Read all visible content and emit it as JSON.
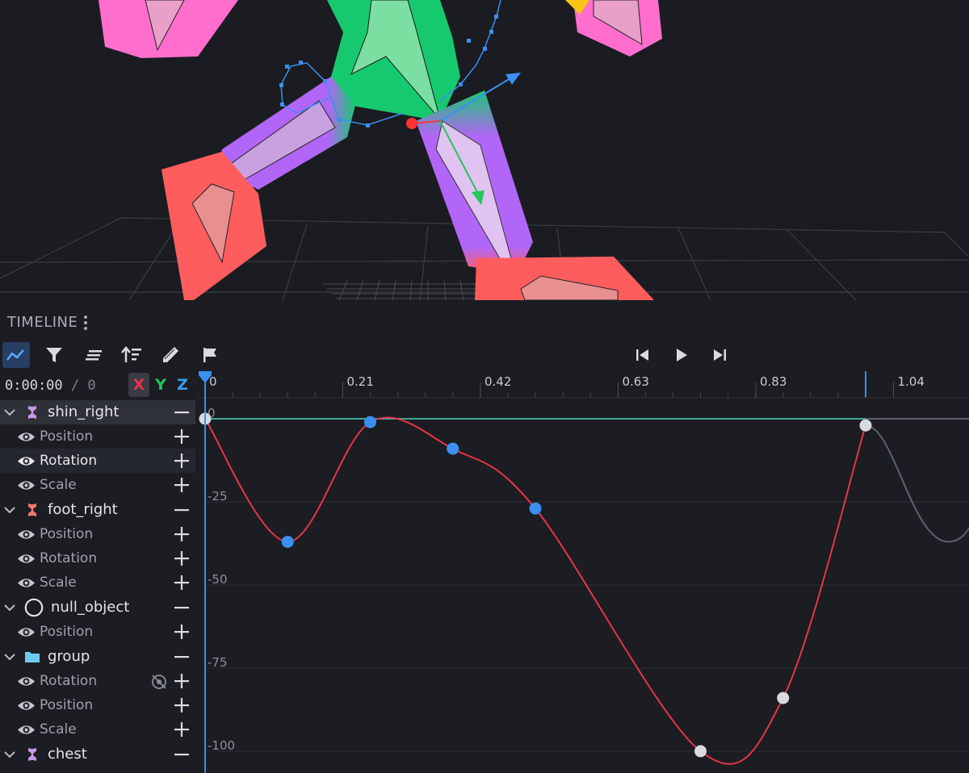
{
  "timeline": {
    "title": "TIMELINE",
    "toolbar": {
      "graph_icon": "graph-editor-icon",
      "filter_icon": "filter-icon",
      "list_icon": "list-icon",
      "sort_icon": "sort-icon",
      "pen_icon": "pen-icon",
      "flag_icon": "flag-icon",
      "skip_back_icon": "skip-to-start-icon",
      "play_icon": "play-icon",
      "skip_forward_icon": "skip-to-end-icon"
    },
    "time": {
      "current": "0:00:00",
      "separator": "/",
      "frame": "0"
    },
    "axes": [
      {
        "label": "X",
        "color": "#e8334a",
        "active": true
      },
      {
        "label": "Y",
        "color": "#23c55e",
        "active": false
      },
      {
        "label": "Z",
        "color": "#3b9cf0",
        "active": false
      }
    ],
    "ruler": {
      "labels": [
        "0",
        "0.21",
        "0.42",
        "0.63",
        "0.83",
        "1.04"
      ]
    },
    "value_axis": {
      "labels": [
        "0",
        "-25",
        "-50",
        "-75",
        "-100"
      ]
    },
    "tracks": [
      {
        "name": "shin_right",
        "icon": "bone-icon",
        "icon_color": "#c59ae8",
        "selected": true,
        "channels": [
          "Position",
          "Rotation",
          "Scale"
        ],
        "highlighted_channel": "Rotation"
      },
      {
        "name": "foot_right",
        "icon": "bone-icon",
        "icon_color": "#f0786e",
        "selected": false,
        "channels": [
          "Position",
          "Rotation",
          "Scale"
        ]
      },
      {
        "name": "null_object",
        "icon": "circle-icon",
        "icon_color": "#e3e5ea",
        "selected": false,
        "channels": [
          "Position"
        ]
      },
      {
        "name": "group",
        "icon": "folder-icon",
        "icon_color": "#6fcaf2",
        "selected": false,
        "channels": [
          "Rotation",
          "Position",
          "Scale"
        ]
      },
      {
        "name": "chest",
        "icon": "bone-icon",
        "icon_color": "#c59ae8",
        "selected": false,
        "channels": []
      }
    ],
    "colors": {
      "x_curve": "#e8334a",
      "flat_curve": "#3ea99a",
      "ghost_curve": "#5d6270",
      "keyframe_selected": "#3b8ff0",
      "keyframe": "#d9dadd",
      "playhead": "#3b8ff0"
    }
  },
  "chart_data": {
    "type": "line",
    "title": "",
    "xlabel": "",
    "ylabel": "",
    "ylim": [
      -105,
      5
    ],
    "xlim": [
      0,
      1.17
    ],
    "series": [
      {
        "keyframes": [
          {
            "x": 0.0,
            "y": 0,
            "selected": false
          },
          {
            "x": 0.125,
            "y": -37,
            "selected": true
          },
          {
            "x": 0.25,
            "y": -1,
            "selected": true
          },
          {
            "x": 0.375,
            "y": -9,
            "selected": true
          },
          {
            "x": 0.5,
            "y": -27,
            "selected": true
          },
          {
            "x": 0.75,
            "y": -100,
            "selected": false
          },
          {
            "x": 0.875,
            "y": -84,
            "selected": false
          },
          {
            "x": 1.0,
            "y": -2,
            "selected": false
          }
        ]
      }
    ]
  }
}
